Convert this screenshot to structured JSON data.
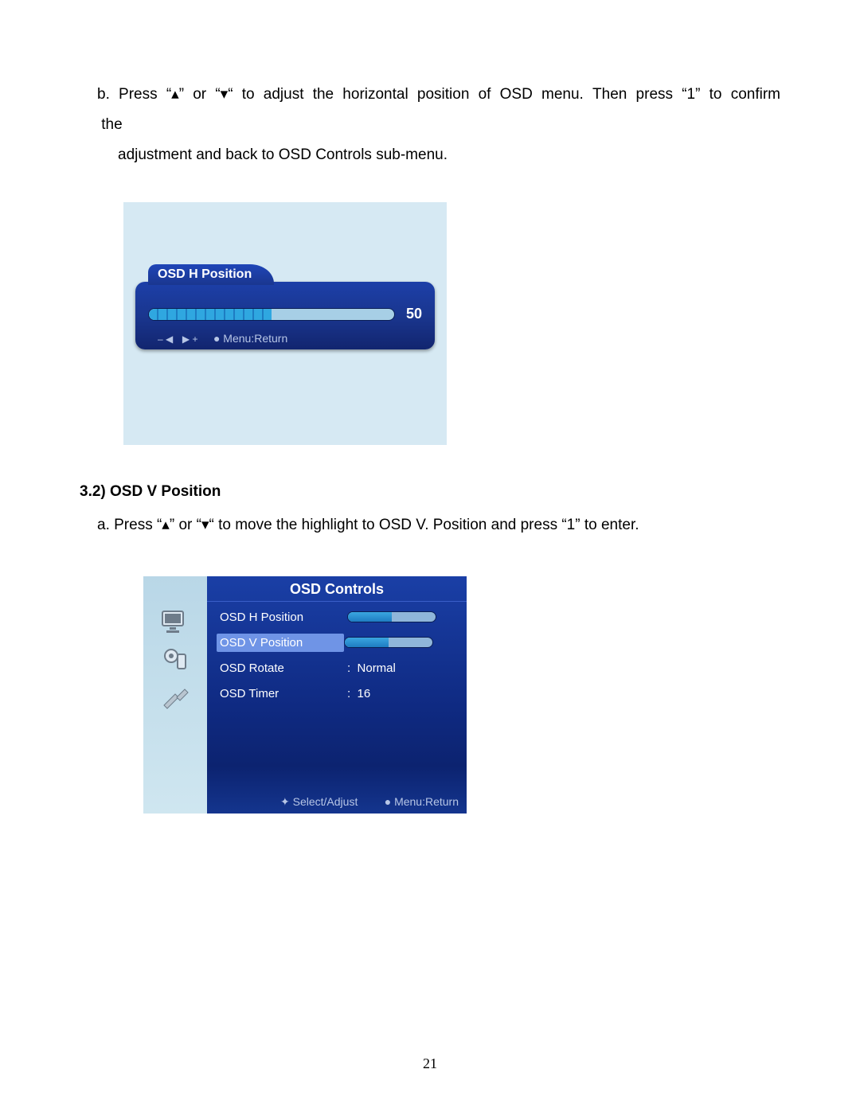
{
  "text": {
    "b_line1": "b.  Press  “▴”  or  “▾“  to  adjust  the  horizontal  position  of  OSD  menu.  Then  press  “1”  to  confirm  the",
    "b_line2": "adjustment and back to OSD Controls sub-menu.",
    "heading": "3.2) OSD V Position",
    "a_line": "a. Press “▴” or “▾“ to move the highlight to OSD V. Position and press “1” to enter.",
    "page_number": "21"
  },
  "fig1": {
    "tab_title": "OSD H Position",
    "value": "50",
    "hint_minus": "– ◀",
    "hint_plus": "▶ +",
    "hint_return": "● Menu:Return"
  },
  "fig2": {
    "title": "OSD Controls",
    "rows": [
      {
        "label": "OSD H Position",
        "type": "slider",
        "highlight": false
      },
      {
        "label": "OSD V Position",
        "type": "slider",
        "highlight": true
      },
      {
        "label": "OSD Rotate",
        "type": "text",
        "value": "Normal"
      },
      {
        "label": "OSD Timer",
        "type": "text",
        "value": "16"
      }
    ],
    "footer_left": "✦ Select/Adjust",
    "footer_right": "● Menu:Return"
  }
}
